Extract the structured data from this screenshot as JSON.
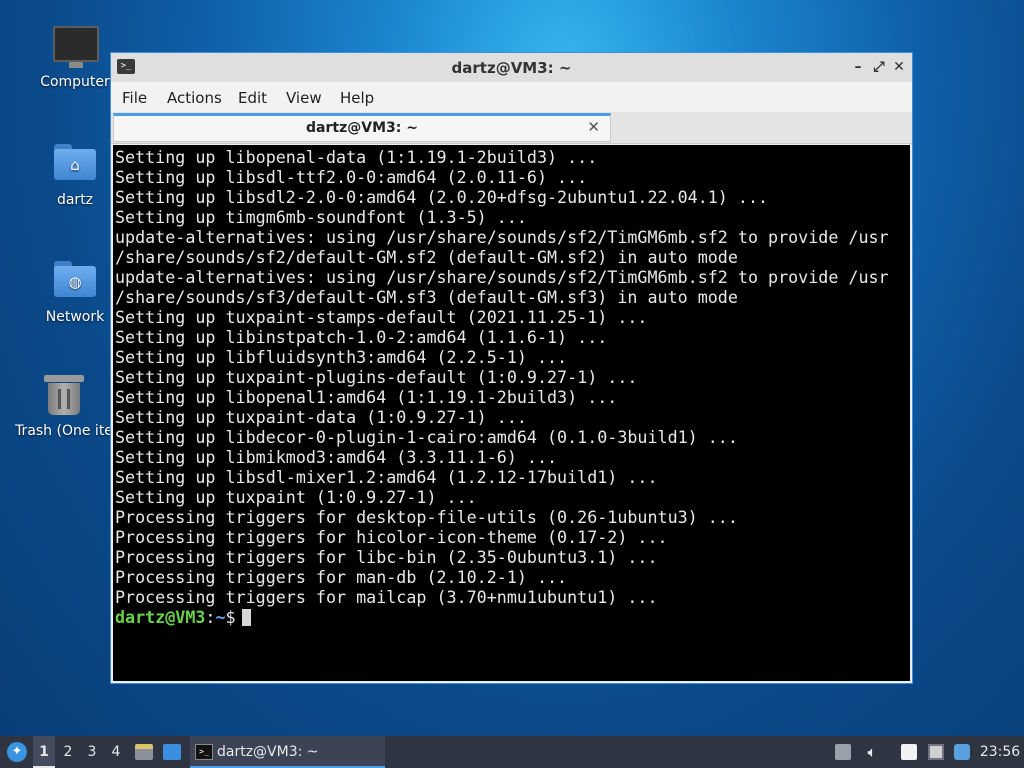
{
  "desktop": {
    "icons": [
      {
        "label": "Computer",
        "icon": "computer-icon"
      },
      {
        "label": "dartz",
        "icon": "home-folder-icon"
      },
      {
        "label": "Network",
        "icon": "network-folder-icon"
      },
      {
        "label": "Trash (One ite",
        "icon": "trash-icon"
      }
    ]
  },
  "window": {
    "title": "dartz@VM3: ~",
    "controls": {
      "minimize": "–",
      "maximize": "⤢",
      "close": "✕"
    },
    "menu": [
      "File",
      "Actions",
      "Edit",
      "View",
      "Help"
    ],
    "tab": {
      "label": "dartz@VM3: ~",
      "close": "✕"
    },
    "terminal": {
      "lines": [
        "Setting up libopenal-data (1:1.19.1-2build3) ...",
        "Setting up libsdl-ttf2.0-0:amd64 (2.0.11-6) ...",
        "Setting up libsdl2-2.0-0:amd64 (2.0.20+dfsg-2ubuntu1.22.04.1) ...",
        "Setting up timgm6mb-soundfont (1.3-5) ...",
        "update-alternatives: using /usr/share/sounds/sf2/TimGM6mb.sf2 to provide /usr",
        "/share/sounds/sf2/default-GM.sf2 (default-GM.sf2) in auto mode",
        "update-alternatives: using /usr/share/sounds/sf2/TimGM6mb.sf2 to provide /usr",
        "/share/sounds/sf3/default-GM.sf3 (default-GM.sf3) in auto mode",
        "Setting up tuxpaint-stamps-default (2021.11.25-1) ...",
        "Setting up libinstpatch-1.0-2:amd64 (1.1.6-1) ...",
        "Setting up libfluidsynth3:amd64 (2.2.5-1) ...",
        "Setting up tuxpaint-plugins-default (1:0.9.27-1) ...",
        "Setting up libopenal1:amd64 (1:1.19.1-2build3) ...",
        "Setting up tuxpaint-data (1:0.9.27-1) ...",
        "Setting up libdecor-0-plugin-1-cairo:amd64 (0.1.0-3build1) ...",
        "Setting up libmikmod3:amd64 (3.3.11.1-6) ...",
        "Setting up libsdl-mixer1.2:amd64 (1.2.12-17build1) ...",
        "Setting up tuxpaint (1:0.9.27-1) ...",
        "Processing triggers for desktop-file-utils (0.26-1ubuntu3) ...",
        "Processing triggers for hicolor-icon-theme (0.17-2) ...",
        "Processing triggers for libc-bin (2.35-0ubuntu3.1) ...",
        "Processing triggers for man-db (2.10.2-1) ...",
        "Processing triggers for mailcap (3.70+nmu1ubuntu1) ..."
      ],
      "prompt": {
        "user": "dartz@VM3",
        "sep": ":",
        "path": "~",
        "symbol": "$"
      }
    }
  },
  "taskbar": {
    "workspaces": [
      "1",
      "2",
      "3",
      "4"
    ],
    "active_workspace": "1",
    "task": {
      "label": "dartz@VM3: ~"
    },
    "clock": "23:56",
    "colors": {
      "accent": "#4aa0e8",
      "panel": "#2e3442"
    }
  }
}
